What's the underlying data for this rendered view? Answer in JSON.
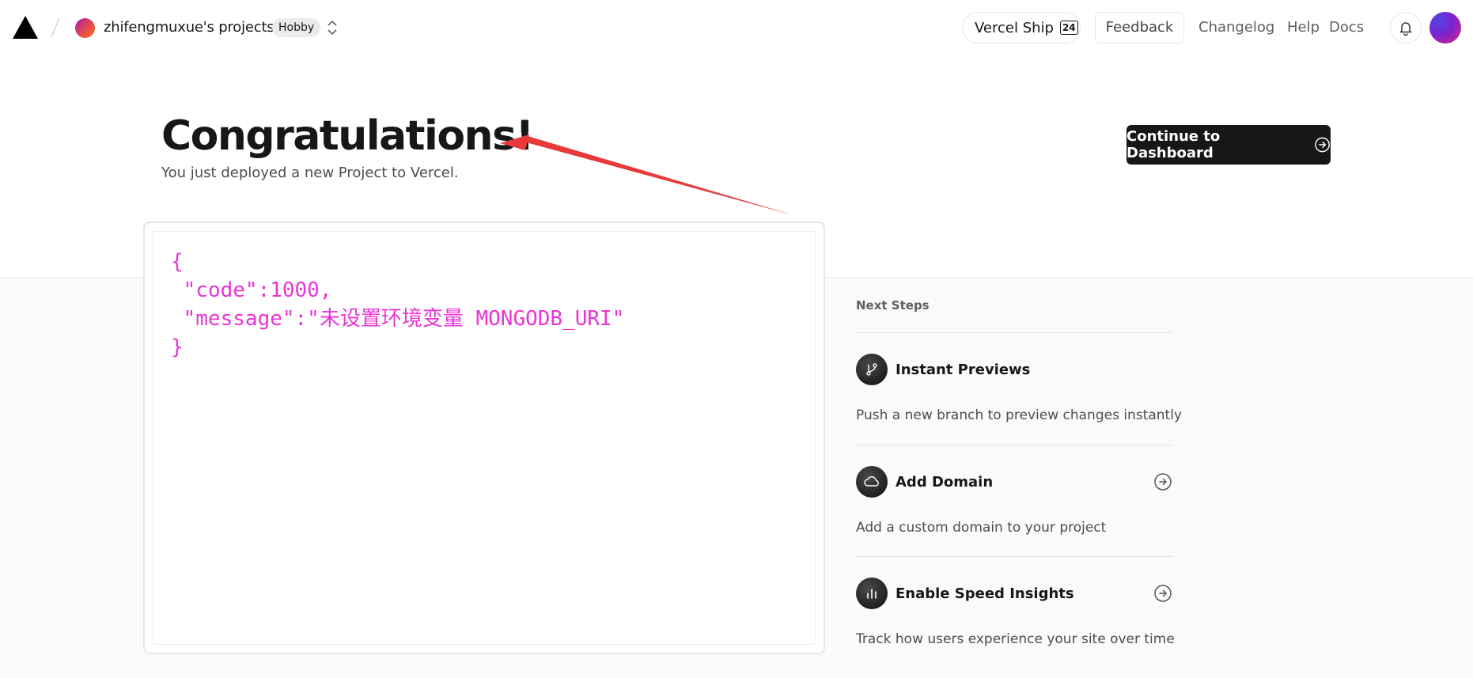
{
  "header": {
    "team_name": "zhifengmuxue's projects",
    "plan": "Hobby",
    "ship_label": "Vercel Ship",
    "ship_number": "24",
    "feedback_label": "Feedback",
    "links": [
      "Changelog",
      "Help",
      "Docs"
    ]
  },
  "hero": {
    "title": "Congratulations!",
    "subtitle": "You just deployed a new Project to Vercel.",
    "continue_label": "Continue to Dashboard"
  },
  "preview": {
    "content": "{\n \"code\":1000,\n \"message\":\"未设置环境变量 MONGODB_URI\"\n}"
  },
  "next_steps": {
    "title": "Next Steps",
    "items": [
      {
        "title": "Instant Previews",
        "description": "Push a new branch to preview changes instantly",
        "icon": "git-branch-icon"
      },
      {
        "title": "Add Domain",
        "description": "Add a custom domain to your project",
        "icon": "cloud-icon"
      },
      {
        "title": "Enable Speed Insights",
        "description": "Track how users experience your site over time",
        "icon": "bar-chart-icon"
      }
    ]
  },
  "colors": {
    "json_text": "#e935d6",
    "annotation_arrow": "#e83a3a",
    "primary_button": "#171717"
  }
}
